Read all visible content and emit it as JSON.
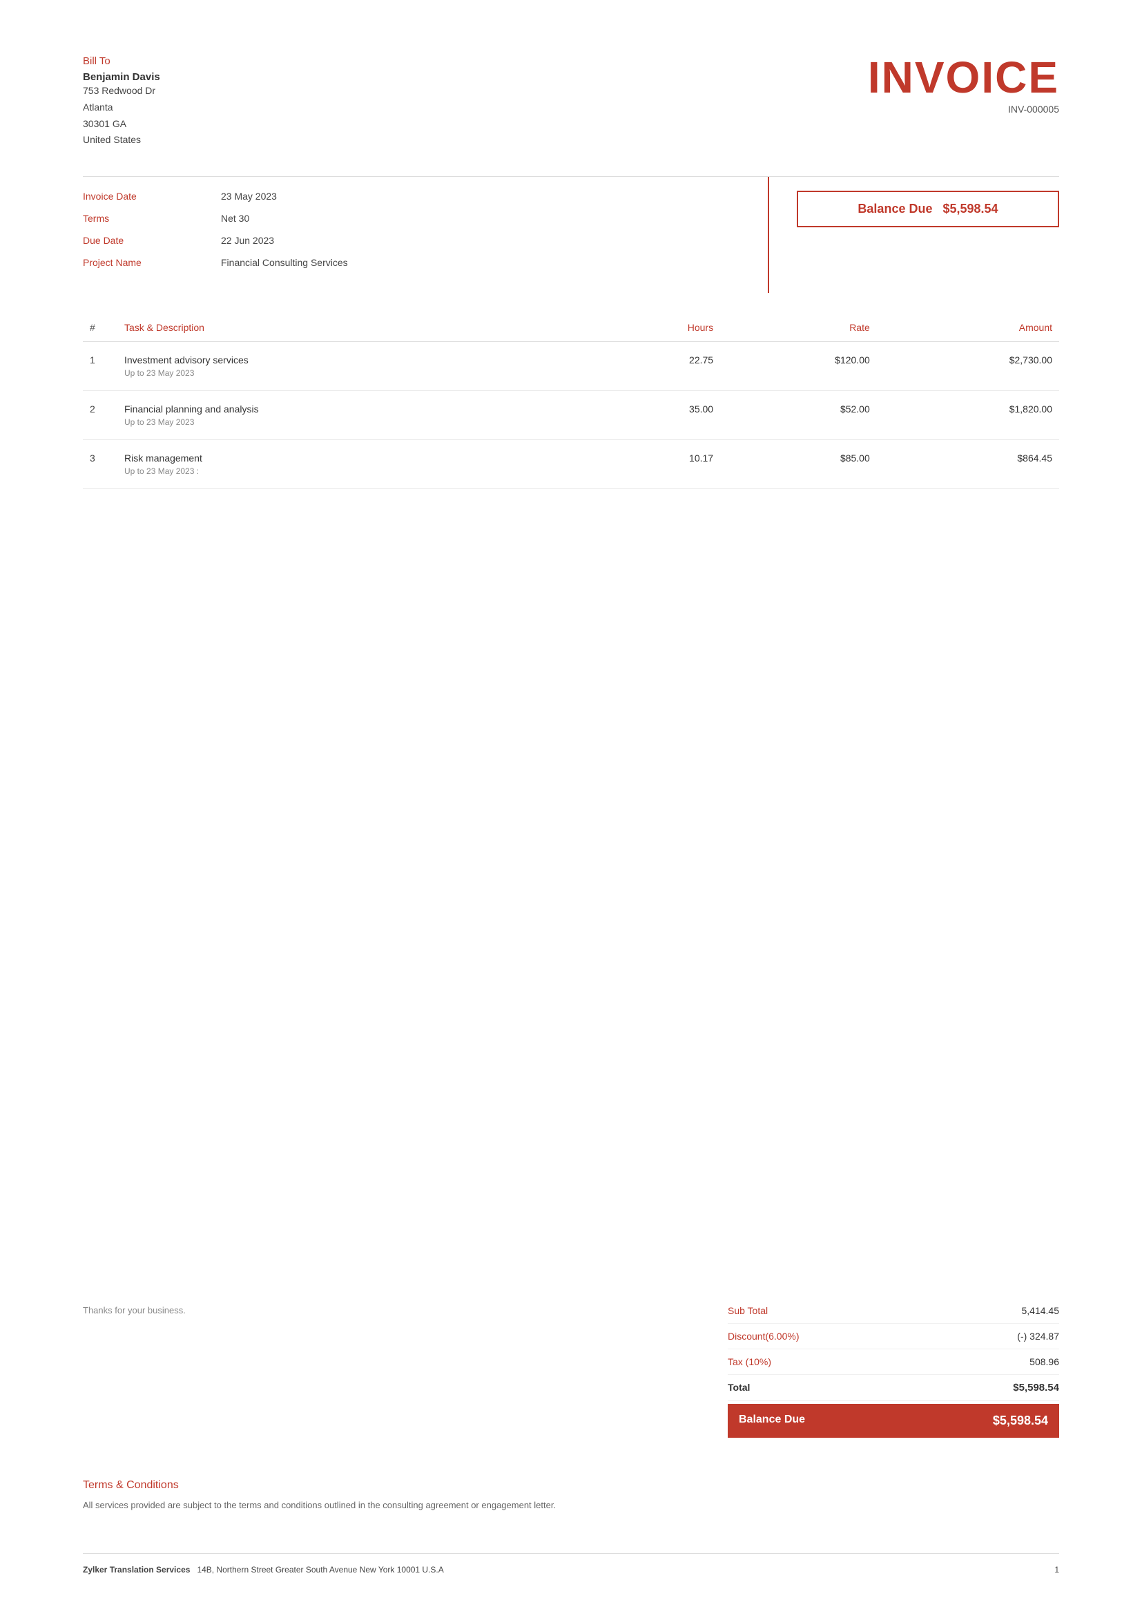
{
  "bill_to": {
    "label": "Bill To",
    "name": "Benjamin Davis",
    "address_line1": "753 Redwood Dr",
    "address_line2": "Atlanta",
    "address_line3": "30301 GA",
    "country": "United States"
  },
  "invoice": {
    "title": "INVOICE",
    "number": "INV-000005"
  },
  "info": {
    "invoice_date_label": "Invoice Date",
    "invoice_date_value": "23 May 2023",
    "terms_label": "Terms",
    "terms_value": "Net 30",
    "due_date_label": "Due Date",
    "due_date_value": "22 Jun 2023",
    "project_name_label": "Project Name",
    "project_name_value": "Financial Consulting Services",
    "balance_due_label": "Balance Due",
    "balance_due_value": "$5,598.54"
  },
  "table": {
    "col_num": "#",
    "col_task": "Task & Description",
    "col_hours": "Hours",
    "col_rate": "Rate",
    "col_amount": "Amount",
    "items": [
      {
        "num": "1",
        "task": "Investment advisory services",
        "sub": "Up to 23 May 2023",
        "hours": "22.75",
        "rate": "$120.00",
        "amount": "$2,730.00"
      },
      {
        "num": "2",
        "task": "Financial planning and analysis",
        "sub": "Up to 23 May 2023",
        "hours": "35.00",
        "rate": "$52.00",
        "amount": "$1,820.00"
      },
      {
        "num": "3",
        "task": "Risk management",
        "sub": "Up to 23 May 2023 :",
        "hours": "10.17",
        "rate": "$85.00",
        "amount": "$864.45"
      }
    ]
  },
  "thanks": "Thanks for your business.",
  "totals": {
    "subtotal_label": "Sub Total",
    "subtotal_value": "5,414.45",
    "discount_label": "Discount(6.00%)",
    "discount_value": "(-) 324.87",
    "tax_label": "Tax (10%)",
    "tax_value": "508.96",
    "total_label": "Total",
    "total_value": "$5,598.54",
    "balance_due_label": "Balance Due",
    "balance_due_value": "$5,598.54"
  },
  "terms": {
    "title": "Terms & Conditions",
    "body": "All services provided are subject to the terms and conditions outlined in the consulting agreement or engagement letter."
  },
  "footer": {
    "company_name": "Zylker Translation Services",
    "company_address": "14B, Northern Street Greater South Avenue New York 10001 U.S.A",
    "page": "1"
  }
}
